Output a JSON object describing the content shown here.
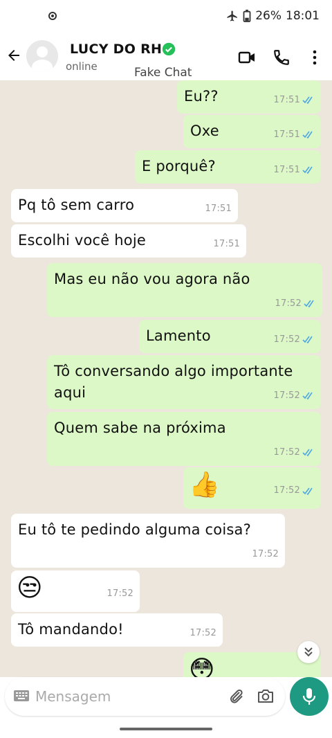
{
  "status_bar": {
    "battery": "26%",
    "time": "18:01"
  },
  "header": {
    "name": "LUCY DO RH",
    "status": "online",
    "overlay": "Fake Chat"
  },
  "messages": [
    {
      "dir": "out",
      "text": "Eu??",
      "time": "17:51"
    },
    {
      "dir": "out",
      "text": "Oxe",
      "time": "17:51"
    },
    {
      "dir": "out",
      "text": "E porquê?",
      "time": "17:51"
    },
    {
      "dir": "in",
      "text": "Pq tô sem carro",
      "time": "17:51"
    },
    {
      "dir": "in",
      "text": "Escolhi você hoje",
      "time": "17:51"
    },
    {
      "dir": "out",
      "text": "Mas eu não vou agora não",
      "time": "17:52"
    },
    {
      "dir": "out",
      "text": "Lamento",
      "time": "17:52"
    },
    {
      "dir": "out",
      "text": "Tô conversando algo importante aqui",
      "time": "17:52"
    },
    {
      "dir": "out",
      "text": "Quem sabe na próxima",
      "time": "17:52"
    },
    {
      "dir": "out",
      "text": "👍",
      "time": "17:52"
    },
    {
      "dir": "in",
      "text": "Eu tô te pedindo alguma coisa?",
      "time": "17:52"
    },
    {
      "dir": "in",
      "text": "😒",
      "time": "17:52"
    },
    {
      "dir": "in",
      "text": "Tô mandando!",
      "time": "17:52"
    },
    {
      "dir": "out",
      "text": "😳",
      "time": ""
    }
  ],
  "composer": {
    "placeholder": "Mensagem"
  },
  "colors": {
    "outgoing": "#dcf8c6",
    "incoming": "#ffffff",
    "accent": "#1f9a82",
    "tick": "#4fa7e0"
  }
}
